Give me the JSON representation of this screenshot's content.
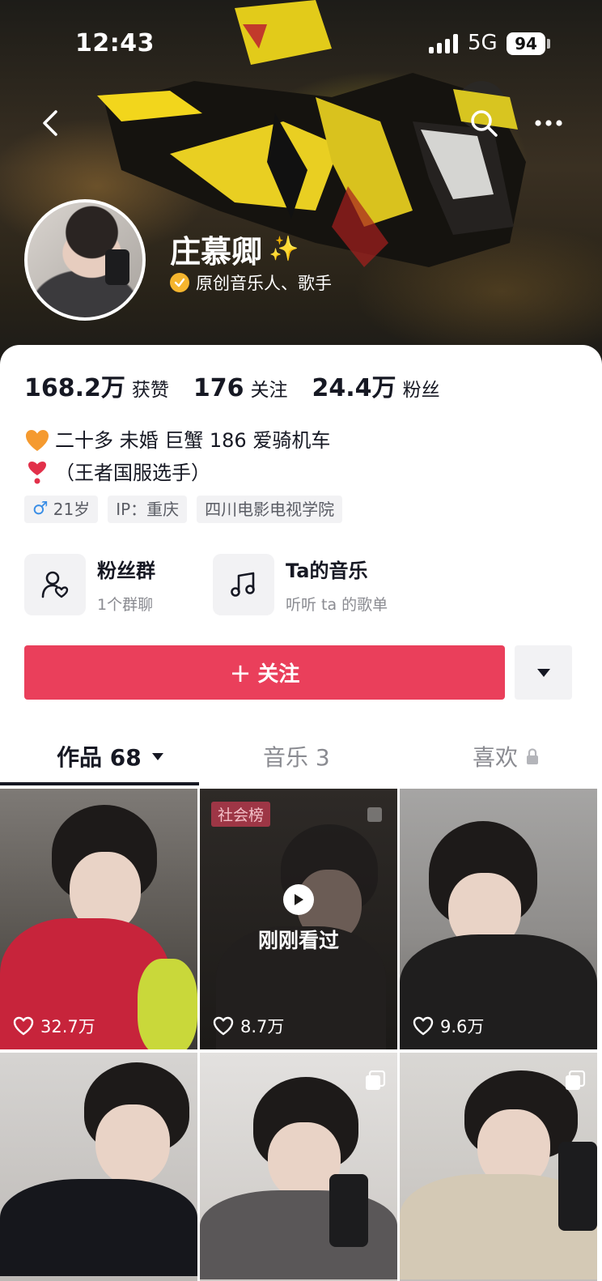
{
  "status_bar": {
    "time": "12:43",
    "network": "5G",
    "battery": "94"
  },
  "profile": {
    "name": "庄慕卿",
    "name_emoji": "✨",
    "verify_text": "原创音乐人、歌手",
    "stats": [
      {
        "num": "168.2万",
        "label": "获赞"
      },
      {
        "num": "176",
        "label": "关注"
      },
      {
        "num": "24.4万",
        "label": "粉丝"
      }
    ],
    "bio_lines": [
      {
        "emoji": "🧡",
        "text": "二十多 未婚 巨蟹 186 爱骑机车"
      },
      {
        "emoji": "❣️",
        "text": "（王者国服选手）"
      }
    ],
    "tags": {
      "gender_symbol": "♂",
      "age": "21岁",
      "ip": "IP：重庆",
      "school": "四川电影电视学院"
    }
  },
  "entries": [
    {
      "title": "粉丝群",
      "sub": "1个群聊",
      "icon": "fan-group-icon"
    },
    {
      "title": "Ta的音乐",
      "sub": "听听 ta 的歌单",
      "icon": "music-note-icon"
    }
  ],
  "follow": {
    "plus": "+",
    "label": "关注"
  },
  "tabs": [
    {
      "label": "作品 68",
      "active": true
    },
    {
      "label": "音乐 3",
      "active": false
    },
    {
      "label": "喜欢",
      "active": false
    }
  ],
  "videos": [
    {
      "likes": "32.7万"
    },
    {
      "likes": "8.7万",
      "badge": "社会榜",
      "overlay": "刚刚看过"
    },
    {
      "likes": "9.6万"
    },
    {},
    {},
    {}
  ],
  "colors": {
    "accent": "#ea3f5b",
    "verify": "#f5b52e",
    "male": "#3a8ee6"
  }
}
